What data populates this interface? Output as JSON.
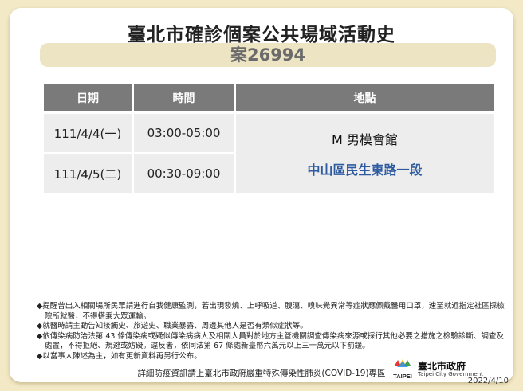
{
  "title": "臺北市確診個案公共場域活動史",
  "case_label": "案26994",
  "table": {
    "headers": [
      "日期",
      "時間",
      "地點"
    ],
    "rows": [
      {
        "date": "111/4/4(一)",
        "time": "03:00-05:00"
      },
      {
        "date": "111/4/5(二)",
        "time": "00:30-09:00"
      }
    ],
    "place_name": "M 男模會館",
    "place_address": "中山區民生東路一段"
  },
  "notes": [
    "◆提醒曾出入相關場所民眾請進行自我健康監測，若出現發燒、上呼吸道、腹瀉、嗅味覺異常等症狀應佩戴醫用口罩，速至就近指定社區採檢院所就醫，不得搭乘大眾運輸。",
    "◆就醫時請主動告知接觸史、旅遊史、職業暴露、周邊其他人是否有類似症狀等。",
    "◆依傳染病防治法第 43 條傳染病或疑似傳染病病人及相關人員對於地方主管機關調查傳染病來源或採行其他必要之措施之檢驗診斷、調查及處置，不得拒絕、規避或妨礙。違反者，依同法第 67 條處新臺幣六萬元以上三十萬元以下罰鍰。",
    "◆以當事人陳述為主，如有更新資料再另行公布。"
  ],
  "logo": {
    "mark_text": "TAIPEI",
    "name_cn": "臺北市政府",
    "name_en": "Taipei City Government"
  },
  "footer": "詳細防疫資訊請上臺北市政府嚴重特殊傳染性肺炎(COVID-19)專區",
  "date": "2022/4/10"
}
